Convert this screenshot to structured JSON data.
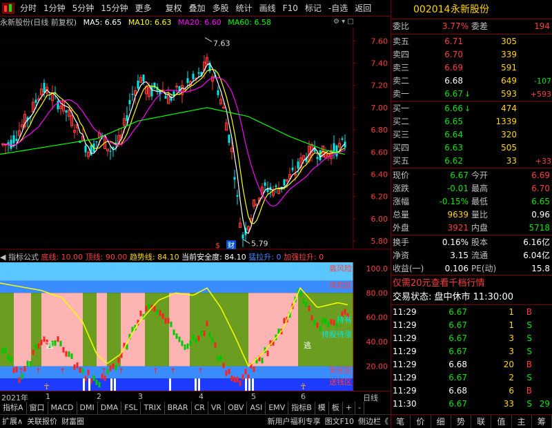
{
  "toolbar": {
    "items": [
      "分时",
      "1分钟",
      "5分钟",
      "15分钟",
      "更多",
      "复权",
      "叠加",
      "多股",
      "统计",
      "画线",
      "F10",
      "标记",
      "-自选",
      "返回"
    ]
  },
  "chart_header": {
    "stock": "永新股份(日线 前复权)",
    "ma5": "MA5: 6.65",
    "ma10": "MA10: 6.63",
    "ma20": "MA20: 6.60",
    "ma60": "MA60: 6.58"
  },
  "main_chart": {
    "y_ticks": [
      "7.60",
      "7.40",
      "7.20",
      "7.00",
      "6.80",
      "6.60",
      "6.40",
      "6.20",
      "6.00",
      "5.80"
    ],
    "high_label": "7.63",
    "low_label": "5.79",
    "cai_label": "财"
  },
  "indicator_header": {
    "name": "指标公式",
    "low_line": "底线: 10.00",
    "top_line": "顶线: 90.00",
    "trend_line": "趋势线: 84.10",
    "safety": "当前安全度: 84.10",
    "pull": "猛拉升: 0",
    "strong": "加强拉升: 0"
  },
  "indicator_chart": {
    "y_ticks": [
      "100.0",
      "80.00",
      "60.00",
      "40.00",
      "20.00"
    ],
    "zone_labels": [
      "高风险",
      "风险区",
      "持有",
      "持股待涨",
      "安全区",
      "送钱区"
    ],
    "escape_label": "逃"
  },
  "date_axis": {
    "labels": [
      "2021年",
      "1",
      "2",
      "3",
      "4",
      "5",
      "6"
    ],
    "period": "日线"
  },
  "tabs": [
    "指标A",
    "窗口",
    "MACD",
    "DMI",
    "DMA",
    "FSL",
    "TRIX",
    "BRAR",
    "CR",
    "VR",
    "OBV",
    "ASI",
    "EMV",
    "指标B",
    "模",
    "板",
    "+",
    "-"
  ],
  "status_bar": {
    "left": [
      "扩展∧",
      "关联报价",
      "财富圈"
    ],
    "right": [
      "新用户福利专享",
      "图文F10",
      "侧边栏《"
    ]
  },
  "quote": {
    "code": "002014",
    "name": "永新股份",
    "weibi_label": "委比",
    "weibi_value": "3.77%",
    "weicha_label": "委差",
    "weicha_value": "194",
    "sells": [
      {
        "label": "卖五",
        "price": "6.71",
        "vol": "305",
        "chg": ""
      },
      {
        "label": "卖四",
        "price": "6.70",
        "vol": "339",
        "chg": ""
      },
      {
        "label": "卖三",
        "price": "6.69",
        "vol": "591",
        "chg": ""
      },
      {
        "label": "卖二",
        "price": "6.68",
        "vol": "649",
        "chg": "-107"
      },
      {
        "label": "卖一",
        "price": "6.67",
        "vol": "593",
        "chg": "+593"
      }
    ],
    "buys": [
      {
        "label": "买一",
        "price": "6.66",
        "vol": "474",
        "chg": ""
      },
      {
        "label": "买二",
        "price": "6.65",
        "vol": "1339",
        "chg": ""
      },
      {
        "label": "买三",
        "price": "6.64",
        "vol": "320",
        "chg": ""
      },
      {
        "label": "买四",
        "price": "6.63",
        "vol": "505",
        "chg": ""
      },
      {
        "label": "买五",
        "price": "6.62",
        "vol": "33",
        "chg": "+33"
      }
    ],
    "stats": [
      {
        "l1": "现价",
        "v1": "6.67",
        "l2": "今开",
        "v2": "6.69"
      },
      {
        "l1": "涨跌",
        "v1": "-0.01",
        "l2": "最高",
        "v2": "6.70"
      },
      {
        "l1": "涨幅",
        "v1": "-0.15%",
        "l2": "最低",
        "v2": "6.65"
      },
      {
        "l1": "总量",
        "v1": "9639",
        "l2": "量比",
        "v2": "0.96"
      },
      {
        "l1": "外盘",
        "v1": "3921",
        "l2": "内盘",
        "v2": "5718"
      }
    ],
    "stats2": [
      {
        "l1": "换手",
        "v1": "0.16%",
        "l2": "股本",
        "v2": "6.16亿"
      },
      {
        "l1": "净资",
        "v1": "3.15",
        "l2": "流通",
        "v2": "6.04亿"
      },
      {
        "l1": "收益(一)",
        "v1": "0.106",
        "l2": "PE(动)",
        "v2": "15.8"
      }
    ],
    "promo": "仅需20元查看千档行情",
    "trade_status": "交易状态: 盘中休市 11:30:00",
    "ticks": [
      {
        "t": "11:29",
        "p": "6.67",
        "v": "1",
        "d": "B"
      },
      {
        "t": "11:29",
        "p": "6.67",
        "v": "1",
        "d": "S"
      },
      {
        "t": "11:29",
        "p": "6.67",
        "v": "3",
        "d": "S"
      },
      {
        "t": "11:29",
        "p": "6.67",
        "v": "3",
        "d": "S"
      },
      {
        "t": "11:29",
        "p": "6.68",
        "v": "20",
        "d": "B"
      },
      {
        "t": "11:29",
        "p": "6.67",
        "v": "2",
        "d": "S"
      },
      {
        "t": "11:29",
        "p": "6.68",
        "v": "6",
        "d": "B"
      },
      {
        "t": "11:30",
        "p": "6.67",
        "v": "33",
        "d": "S",
        "extra": "29"
      }
    ],
    "bottom_tabs": [
      "笔",
      "价",
      "细",
      "势",
      "联",
      "值",
      "主",
      "筹"
    ]
  },
  "colors": {
    "up": "#ff3c3c",
    "down": "#00e800",
    "ma5": "#ffffff",
    "ma10": "#ffff00",
    "ma20": "#ff00ff",
    "ma60": "#00ff00"
  }
}
